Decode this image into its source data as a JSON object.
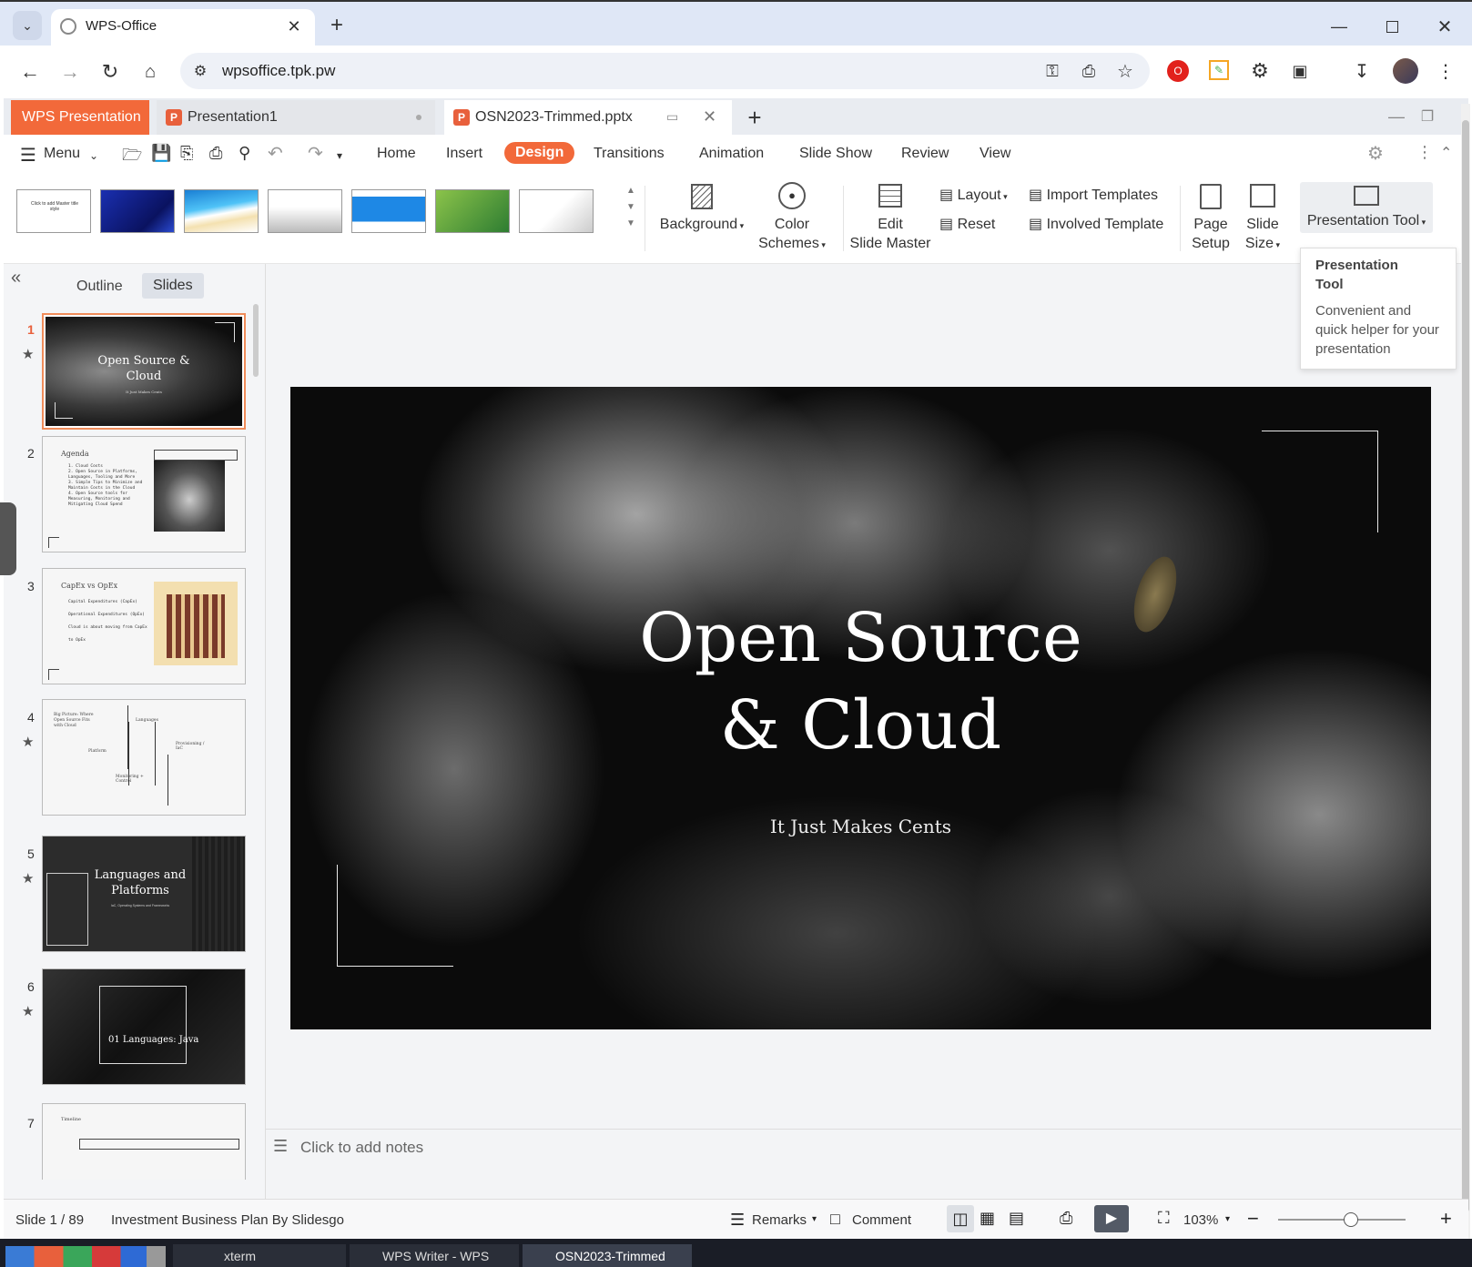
{
  "browser": {
    "tab_title": "WPS-Office",
    "url": "wpsoffice.tpk.pw"
  },
  "wps_tabs": {
    "app": "WPS Presentation",
    "doc1": "Presentation1",
    "doc2": "OSN2023-Trimmed.pptx"
  },
  "menu": {
    "menu_label": "Menu",
    "tabs": [
      "Home",
      "Insert",
      "Design",
      "Transitions",
      "Animation",
      "Slide Show",
      "Review",
      "View"
    ]
  },
  "ribbon": {
    "background": "Background",
    "color_schemes": [
      "Color",
      "Schemes"
    ],
    "edit_master": [
      "Edit",
      "Slide Master"
    ],
    "layout": "Layout",
    "reset": "Reset",
    "import_templates": "Import Templates",
    "involved_template": "Involved Template",
    "page_setup": [
      "Page",
      "Setup"
    ],
    "slide_size": [
      "Slide",
      "Size"
    ],
    "presentation_tool": "Presentation Tool",
    "master_thumb_text": "Click to add Master title style"
  },
  "tooltip": {
    "title": "Presentation Tool",
    "body": "Convenient and quick helper for your presentation"
  },
  "panel": {
    "outline_tab": "Outline",
    "slides_tab": "Slides"
  },
  "thumbs": [
    {
      "num": "1",
      "title": "Open Source & Cloud",
      "sub": "It Just Makes Cents"
    },
    {
      "num": "2",
      "title": "Agenda",
      "lines": [
        "1. Cloud Costs",
        "2. Open Source in Platforms, Languages, Tooling and More",
        "3. Simple Tips to Minimize and Maintain Costs in the Cloud",
        "4. Open Source tools for Measuring, Monitoring and Mitigating Cloud Spend"
      ]
    },
    {
      "num": "3",
      "title": "CapEx vs OpEx",
      "lines": [
        "Capital Expenditures (CapEx)",
        "Operational Expenditures (OpEx)",
        "Cloud is about moving from CapEx to OpEx"
      ]
    },
    {
      "num": "4",
      "title": "Big Picture: Where Open Source Fits with Cloud",
      "labels": [
        "Languages",
        "Platform",
        "Provisioning / IaC",
        "Monitoring + Control"
      ]
    },
    {
      "num": "5",
      "title": "Languages and Platforms",
      "sub": "IaC, Operating Systems and Frameworks"
    },
    {
      "num": "6",
      "title": "01   Languages: Java"
    },
    {
      "num": "7",
      "title": "Timeline"
    }
  ],
  "slide": {
    "title_line1": "Open Source",
    "title_line2": "& Cloud",
    "subtitle": "It Just Makes Cents"
  },
  "notes": {
    "placeholder": "Click to add notes"
  },
  "status": {
    "slide_pos": "Slide 1 / 89",
    "theme": "Investment Business Plan By Slidesgo",
    "remarks": "Remarks",
    "comment": "Comment",
    "zoom": "103%"
  },
  "taskbar": {
    "items": [
      "xterm",
      "WPS Writer - WPS",
      "OSN2023-Trimmed"
    ]
  }
}
